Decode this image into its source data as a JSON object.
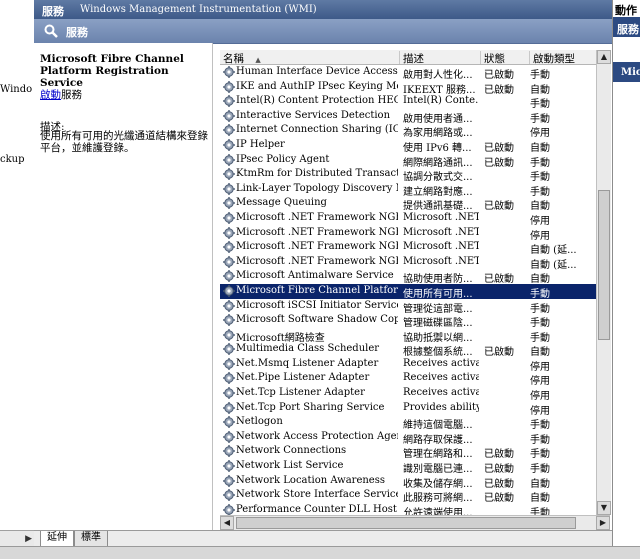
{
  "window": {
    "title": "服務",
    "subtitle": "Windows Management Instrumentation (WMI)",
    "header_label": "服務"
  },
  "left_strip": {
    "fragments": [
      "Windo",
      "ckup"
    ]
  },
  "description_pane": {
    "service_name": "Microsoft Fibre Channel Platform Registration Service",
    "start_link": "啟動",
    "start_suffix": "服務",
    "desc_label": "描述:",
    "desc_text": "使用所有可用的光纖通道結構來登錄平台，並維護登錄。"
  },
  "columns": {
    "name": "名稱",
    "desc": "描述",
    "status": "狀態",
    "start": "啟動類型"
  },
  "services": [
    {
      "name": "Human Interface Device Access",
      "desc": "啟用對人性化...",
      "status": "已啟動",
      "start": "手動"
    },
    {
      "name": "IKE and AuthIP IPsec Keying Modules",
      "desc": "IKEEXT 服務...",
      "status": "已啟動",
      "start": "自動"
    },
    {
      "name": "Intel(R) Content Protection HECI Ser...",
      "desc": "Intel(R) Conte...",
      "status": "",
      "start": "手動"
    },
    {
      "name": "Interactive Services Detection",
      "desc": "啟用使用者通...",
      "status": "",
      "start": "手動"
    },
    {
      "name": "Internet Connection Sharing (ICS)",
      "desc": "為家用網路或...",
      "status": "",
      "start": "停用"
    },
    {
      "name": "IP Helper",
      "desc": "使用 IPv6 轉...",
      "status": "已啟動",
      "start": "自動"
    },
    {
      "name": "IPsec Policy Agent",
      "desc": "網際網路通訊...",
      "status": "已啟動",
      "start": "手動"
    },
    {
      "name": "KtmRm for Distributed Transaction C...",
      "desc": "協調分散式交...",
      "status": "",
      "start": "手動"
    },
    {
      "name": "Link-Layer Topology Discovery Map...",
      "desc": "建立網路對應...",
      "status": "",
      "start": "手動"
    },
    {
      "name": "Message Queuing",
      "desc": "提供通訊基礎...",
      "status": "已啟動",
      "start": "自動"
    },
    {
      "name": "Microsoft .NET Framework NGEN v...",
      "desc": "Microsoft .NET...",
      "status": "",
      "start": "停用"
    },
    {
      "name": "Microsoft .NET Framework NGEN v...",
      "desc": "Microsoft .NET...",
      "status": "",
      "start": "停用"
    },
    {
      "name": "Microsoft .NET Framework NGEN v...",
      "desc": "Microsoft .NET...",
      "status": "",
      "start": "自動 (延..."
    },
    {
      "name": "Microsoft .NET Framework NGEN v...",
      "desc": "Microsoft .NET...",
      "status": "",
      "start": "自動 (延..."
    },
    {
      "name": "Microsoft Antimalware Service",
      "desc": "協助使用者防...",
      "status": "已啟動",
      "start": "自動"
    },
    {
      "name": "Microsoft Fibre Channel Platform Re...",
      "desc": "使用所有可用...",
      "status": "",
      "start": "手動",
      "selected": true
    },
    {
      "name": "Microsoft iSCSI Initiator Service",
      "desc": "管理從這部電...",
      "status": "",
      "start": "手動"
    },
    {
      "name": "Microsoft Software Shadow Copy Pro...",
      "desc": "管理磁碟區陰...",
      "status": "",
      "start": "手動"
    },
    {
      "name": "Microsoft網路檢查",
      "desc": "協助抵禦以網...",
      "status": "",
      "start": "手動"
    },
    {
      "name": "Multimedia Class Scheduler",
      "desc": "根據整個系統...",
      "status": "已啟動",
      "start": "自動"
    },
    {
      "name": "Net.Msmq Listener Adapter",
      "desc": "Receives activa...",
      "status": "",
      "start": "停用"
    },
    {
      "name": "Net.Pipe Listener Adapter",
      "desc": "Receives activa...",
      "status": "",
      "start": "停用"
    },
    {
      "name": "Net.Tcp Listener Adapter",
      "desc": "Receives activa...",
      "status": "",
      "start": "停用"
    },
    {
      "name": "Net.Tcp Port Sharing Service",
      "desc": "Provides ability...",
      "status": "",
      "start": "停用"
    },
    {
      "name": "Netlogon",
      "desc": "維持這個電腦...",
      "status": "",
      "start": "手動"
    },
    {
      "name": "Network Access Protection Agent",
      "desc": "網路存取保護...",
      "status": "",
      "start": "手動"
    },
    {
      "name": "Network Connections",
      "desc": "管理在網路和...",
      "status": "已啟動",
      "start": "手動"
    },
    {
      "name": "Network List Service",
      "desc": "識別電腦已連...",
      "status": "已啟動",
      "start": "手動"
    },
    {
      "name": "Network Location Awareness",
      "desc": "收集及儲存網...",
      "status": "已啟動",
      "start": "自動"
    },
    {
      "name": "Network Store Interface Service",
      "desc": "此服務可將網...",
      "status": "已啟動",
      "start": "自動"
    },
    {
      "name": "Performance Counter DLL Host",
      "desc": "允許遠端使用...",
      "status": "",
      "start": "手動"
    }
  ],
  "tabs": [
    "延伸",
    "標準"
  ],
  "right_pane": {
    "header": "動作",
    "bar_label": "服務",
    "bar2_label": "Mic"
  }
}
